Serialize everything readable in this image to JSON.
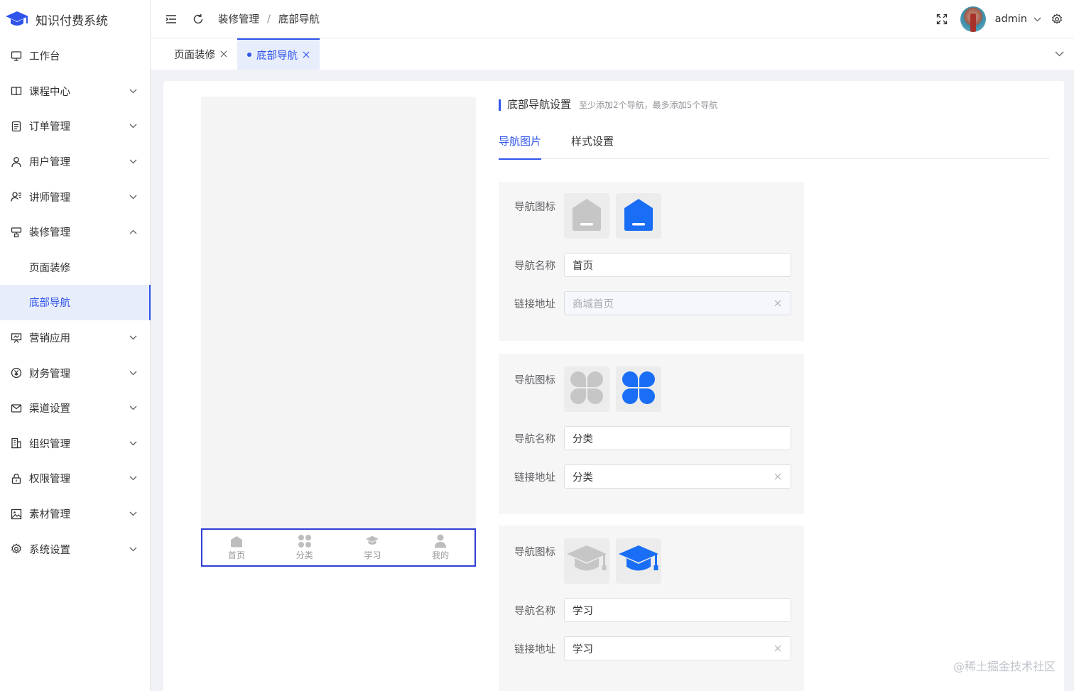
{
  "app": {
    "title": "知识付费系统"
  },
  "sidebar": {
    "items": [
      {
        "label": "工作台",
        "icon": "monitor-icon",
        "chevron": false
      },
      {
        "label": "课程中心",
        "icon": "book-icon",
        "chevron": "down"
      },
      {
        "label": "订单管理",
        "icon": "order-icon",
        "chevron": "down"
      },
      {
        "label": "用户管理",
        "icon": "user-icon",
        "chevron": "down"
      },
      {
        "label": "讲师管理",
        "icon": "teacher-icon",
        "chevron": "down"
      },
      {
        "label": "装修管理",
        "icon": "decorate-icon",
        "chevron": "up"
      },
      {
        "label": "页面装修",
        "sub": true
      },
      {
        "label": "底部导航",
        "sub": true,
        "active": true
      },
      {
        "label": "营销应用",
        "icon": "marketing-icon",
        "chevron": "down"
      },
      {
        "label": "财务管理",
        "icon": "yen-icon",
        "chevron": "down"
      },
      {
        "label": "渠道设置",
        "icon": "mail-icon",
        "chevron": "down"
      },
      {
        "label": "组织管理",
        "icon": "building-icon",
        "chevron": "down"
      },
      {
        "label": "权限管理",
        "icon": "lock-icon",
        "chevron": "down"
      },
      {
        "label": "素材管理",
        "icon": "image-icon",
        "chevron": "down"
      },
      {
        "label": "系统设置",
        "icon": "gear-icon",
        "chevron": "down"
      }
    ]
  },
  "header": {
    "breadcrumb": [
      "装修管理",
      "底部导航"
    ],
    "breadcrumb_sep": "/",
    "user": "admin"
  },
  "tabs": [
    {
      "label": "页面装修",
      "active": false
    },
    {
      "label": "底部导航",
      "active": true
    }
  ],
  "preview": {
    "nav": [
      {
        "label": "首页",
        "icon": "home-icon"
      },
      {
        "label": "分类",
        "icon": "category-icon"
      },
      {
        "label": "学习",
        "icon": "graduation-cap-icon"
      },
      {
        "label": "我的",
        "icon": "person-icon"
      }
    ]
  },
  "settings": {
    "title": "底部导航设置",
    "hint": "至少添加2个导航，最多添加5个导航",
    "tabs": [
      "导航图片",
      "样式设置"
    ],
    "label_icon": "导航图标",
    "label_name": "导航名称",
    "label_link": "链接地址",
    "cards": [
      {
        "name": "首页",
        "link": "商城首页",
        "link_disabled": true,
        "icon": "home-icon"
      },
      {
        "name": "分类",
        "link": "分类",
        "link_disabled": false,
        "icon": "category-icon"
      },
      {
        "name": "学习",
        "link": "学习",
        "link_disabled": false,
        "icon": "graduation-cap-icon"
      }
    ]
  },
  "colors": {
    "accent": "#2f54eb",
    "icon_active": "#1a6ef5",
    "icon_inactive": "#c6c6c6"
  },
  "watermark": "@稀土掘金技术社区"
}
